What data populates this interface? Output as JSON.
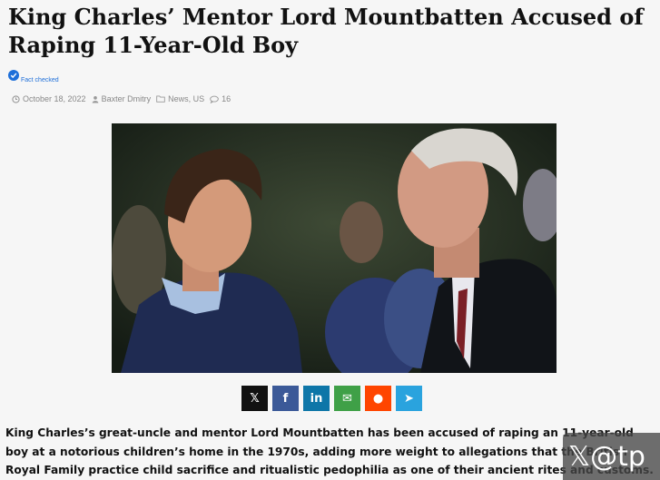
{
  "article": {
    "title": "King Charles’ Mentor Lord Mountbatten Accused of Raping 11-Year-Old Boy",
    "fact_checked": "Fact checked",
    "meta": {
      "date": "October 18, 2022",
      "author": "Baxter Dmitry",
      "categories": "News, US",
      "comments": "16"
    },
    "body": "King Charles’s great-uncle and mentor Lord Mountbatten has been accused of raping an 11-year-old boy at a notorious children’s home in the 1970s, adding more weight to allegations that the British Royal Family practice child sacrifice and ritualistic pedophilia as one of their ancient rites and customs."
  },
  "share": [
    {
      "icon": "x-icon",
      "glyph": "𝕏",
      "color": "#111111"
    },
    {
      "icon": "facebook-icon",
      "glyph": "f",
      "color": "#3b5998"
    },
    {
      "icon": "linkedin-icon",
      "glyph": "in",
      "color": "#0e76a8"
    },
    {
      "icon": "email-icon",
      "glyph": "✉",
      "color": "#3fa047"
    },
    {
      "icon": "reddit-icon",
      "glyph": "●",
      "color": "#ff4500"
    },
    {
      "icon": "telegram-icon",
      "glyph": "➤",
      "color": "#2aa3de"
    }
  ],
  "watermark": {
    "text": "𝕏@tp"
  },
  "colors": {
    "accent": "#1e6fd9",
    "meta_text": "#888888"
  }
}
